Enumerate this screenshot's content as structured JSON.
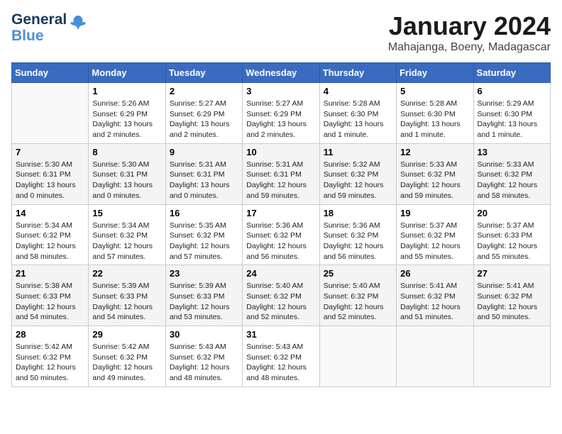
{
  "header": {
    "logo_general": "General",
    "logo_blue": "Blue",
    "month": "January 2024",
    "location": "Mahajanga, Boeny, Madagascar"
  },
  "weekdays": [
    "Sunday",
    "Monday",
    "Tuesday",
    "Wednesday",
    "Thursday",
    "Friday",
    "Saturday"
  ],
  "weeks": [
    [
      {
        "day": "",
        "info": ""
      },
      {
        "day": "1",
        "info": "Sunrise: 5:26 AM\nSunset: 6:29 PM\nDaylight: 13 hours\nand 2 minutes."
      },
      {
        "day": "2",
        "info": "Sunrise: 5:27 AM\nSunset: 6:29 PM\nDaylight: 13 hours\nand 2 minutes."
      },
      {
        "day": "3",
        "info": "Sunrise: 5:27 AM\nSunset: 6:29 PM\nDaylight: 13 hours\nand 2 minutes."
      },
      {
        "day": "4",
        "info": "Sunrise: 5:28 AM\nSunset: 6:30 PM\nDaylight: 13 hours\nand 1 minute."
      },
      {
        "day": "5",
        "info": "Sunrise: 5:28 AM\nSunset: 6:30 PM\nDaylight: 13 hours\nand 1 minute."
      },
      {
        "day": "6",
        "info": "Sunrise: 5:29 AM\nSunset: 6:30 PM\nDaylight: 13 hours\nand 1 minute."
      }
    ],
    [
      {
        "day": "7",
        "info": "Sunrise: 5:30 AM\nSunset: 6:31 PM\nDaylight: 13 hours\nand 0 minutes."
      },
      {
        "day": "8",
        "info": "Sunrise: 5:30 AM\nSunset: 6:31 PM\nDaylight: 13 hours\nand 0 minutes."
      },
      {
        "day": "9",
        "info": "Sunrise: 5:31 AM\nSunset: 6:31 PM\nDaylight: 13 hours\nand 0 minutes."
      },
      {
        "day": "10",
        "info": "Sunrise: 5:31 AM\nSunset: 6:31 PM\nDaylight: 12 hours\nand 59 minutes."
      },
      {
        "day": "11",
        "info": "Sunrise: 5:32 AM\nSunset: 6:32 PM\nDaylight: 12 hours\nand 59 minutes."
      },
      {
        "day": "12",
        "info": "Sunrise: 5:33 AM\nSunset: 6:32 PM\nDaylight: 12 hours\nand 59 minutes."
      },
      {
        "day": "13",
        "info": "Sunrise: 5:33 AM\nSunset: 6:32 PM\nDaylight: 12 hours\nand 58 minutes."
      }
    ],
    [
      {
        "day": "14",
        "info": "Sunrise: 5:34 AM\nSunset: 6:32 PM\nDaylight: 12 hours\nand 58 minutes."
      },
      {
        "day": "15",
        "info": "Sunrise: 5:34 AM\nSunset: 6:32 PM\nDaylight: 12 hours\nand 57 minutes."
      },
      {
        "day": "16",
        "info": "Sunrise: 5:35 AM\nSunset: 6:32 PM\nDaylight: 12 hours\nand 57 minutes."
      },
      {
        "day": "17",
        "info": "Sunrise: 5:36 AM\nSunset: 6:32 PM\nDaylight: 12 hours\nand 56 minutes."
      },
      {
        "day": "18",
        "info": "Sunrise: 5:36 AM\nSunset: 6:32 PM\nDaylight: 12 hours\nand 56 minutes."
      },
      {
        "day": "19",
        "info": "Sunrise: 5:37 AM\nSunset: 6:32 PM\nDaylight: 12 hours\nand 55 minutes."
      },
      {
        "day": "20",
        "info": "Sunrise: 5:37 AM\nSunset: 6:33 PM\nDaylight: 12 hours\nand 55 minutes."
      }
    ],
    [
      {
        "day": "21",
        "info": "Sunrise: 5:38 AM\nSunset: 6:33 PM\nDaylight: 12 hours\nand 54 minutes."
      },
      {
        "day": "22",
        "info": "Sunrise: 5:39 AM\nSunset: 6:33 PM\nDaylight: 12 hours\nand 54 minutes."
      },
      {
        "day": "23",
        "info": "Sunrise: 5:39 AM\nSunset: 6:33 PM\nDaylight: 12 hours\nand 53 minutes."
      },
      {
        "day": "24",
        "info": "Sunrise: 5:40 AM\nSunset: 6:32 PM\nDaylight: 12 hours\nand 52 minutes."
      },
      {
        "day": "25",
        "info": "Sunrise: 5:40 AM\nSunset: 6:32 PM\nDaylight: 12 hours\nand 52 minutes."
      },
      {
        "day": "26",
        "info": "Sunrise: 5:41 AM\nSunset: 6:32 PM\nDaylight: 12 hours\nand 51 minutes."
      },
      {
        "day": "27",
        "info": "Sunrise: 5:41 AM\nSunset: 6:32 PM\nDaylight: 12 hours\nand 50 minutes."
      }
    ],
    [
      {
        "day": "28",
        "info": "Sunrise: 5:42 AM\nSunset: 6:32 PM\nDaylight: 12 hours\nand 50 minutes."
      },
      {
        "day": "29",
        "info": "Sunrise: 5:42 AM\nSunset: 6:32 PM\nDaylight: 12 hours\nand 49 minutes."
      },
      {
        "day": "30",
        "info": "Sunrise: 5:43 AM\nSunset: 6:32 PM\nDaylight: 12 hours\nand 48 minutes."
      },
      {
        "day": "31",
        "info": "Sunrise: 5:43 AM\nSunset: 6:32 PM\nDaylight: 12 hours\nand 48 minutes."
      },
      {
        "day": "",
        "info": ""
      },
      {
        "day": "",
        "info": ""
      },
      {
        "day": "",
        "info": ""
      }
    ]
  ]
}
